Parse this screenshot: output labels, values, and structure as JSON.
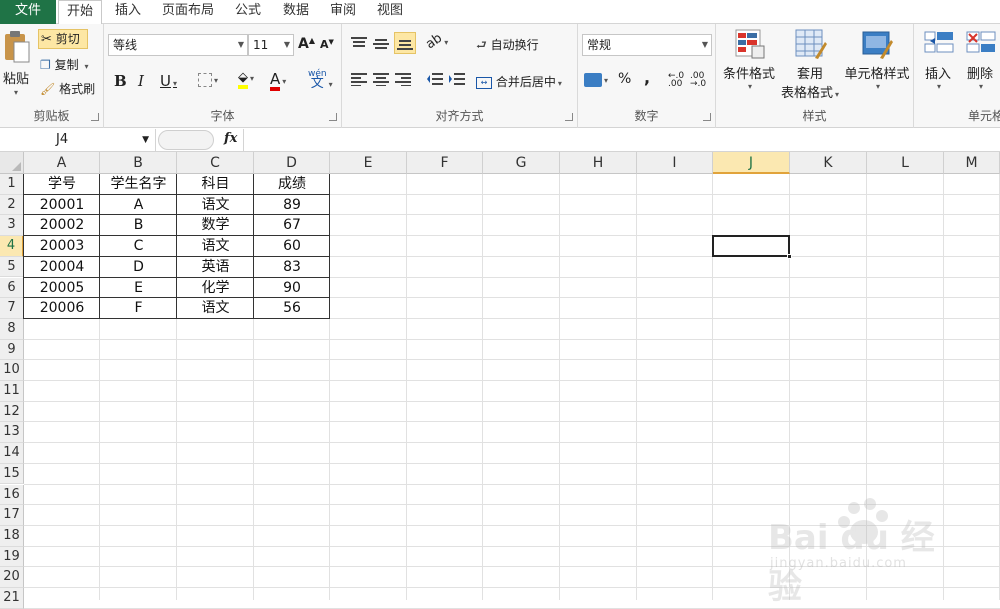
{
  "tabs": [
    "文件",
    "开始",
    "插入",
    "页面布局",
    "公式",
    "数据",
    "审阅",
    "视图"
  ],
  "ribbon": {
    "clipboard": {
      "paste": "粘贴",
      "cut": "剪切",
      "copy": "复制",
      "format_painter": "格式刷",
      "label": "剪贴板"
    },
    "font": {
      "name": "等线",
      "size": "11",
      "bold": "B",
      "italic": "I",
      "underline": "U",
      "grow": "A",
      "shrink": "A",
      "color_a": "A",
      "wen": "wén",
      "label": "字体"
    },
    "alignment": {
      "wrap": "自动换行",
      "merge": "合并后居中",
      "label": "对齐方式"
    },
    "number": {
      "format": "常规",
      "percent": "%",
      "comma": ",",
      "label": "数字"
    },
    "styles": {
      "conditional": "条件格式",
      "table_line1": "套用",
      "table_line2": "表格格式",
      "cell_styles": "单元格样式",
      "label": "样式"
    },
    "cells": {
      "insert": "插入",
      "delete": "删除",
      "label": "单元格"
    }
  },
  "formula_bar": {
    "name_box": "J4",
    "fx": "fx",
    "value": ""
  },
  "columns": [
    "A",
    "B",
    "C",
    "D",
    "E",
    "F",
    "G",
    "H",
    "I",
    "J",
    "K",
    "L",
    "M"
  ],
  "rows": [
    "1",
    "2",
    "3",
    "4",
    "5",
    "6",
    "7",
    "8",
    "9",
    "10",
    "11",
    "12",
    "13",
    "14",
    "15",
    "16",
    "17",
    "18",
    "19",
    "20",
    "21"
  ],
  "selected": {
    "column": "J",
    "row": "4"
  },
  "table": [
    [
      "学号",
      "学生名字",
      "科目",
      "成绩"
    ],
    [
      "20001",
      "A",
      "语文",
      "89"
    ],
    [
      "20002",
      "B",
      "数学",
      "67"
    ],
    [
      "20003",
      "C",
      "语文",
      "60"
    ],
    [
      "20004",
      "D",
      "英语",
      "83"
    ],
    [
      "20005",
      "E",
      "化学",
      "90"
    ],
    [
      "20006",
      "F",
      "语文",
      "56"
    ]
  ],
  "watermark": {
    "main": "Bai du 经验",
    "sub": "jingyan.baidu.com"
  },
  "colors": {
    "excel_green": "#1f7346",
    "selection_amber": "#e1a33b",
    "cut_highlight": "#fde7a4"
  }
}
